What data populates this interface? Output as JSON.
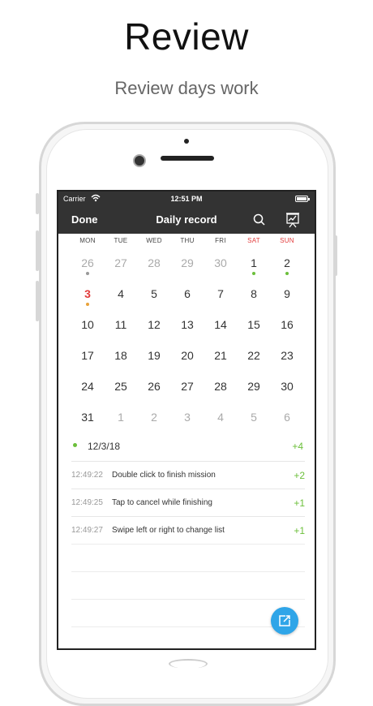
{
  "promo": {
    "title": "Review",
    "subtitle": "Review days work"
  },
  "status_bar": {
    "carrier": "Carrier",
    "time": "12:51 PM",
    "icons": [
      "wifi-icon",
      "battery-icon"
    ]
  },
  "nav": {
    "left_label": "Done",
    "title": "Daily record",
    "right_icons": [
      "search-icon",
      "chart-icon"
    ]
  },
  "calendar": {
    "weekdays": [
      "MON",
      "TUE",
      "WED",
      "THU",
      "FRI",
      "SAT",
      "SUN"
    ],
    "weeks": [
      [
        "26",
        "27",
        "28",
        "29",
        "30",
        "1",
        "2"
      ],
      [
        "3",
        "4",
        "5",
        "6",
        "7",
        "8",
        "9"
      ],
      [
        "10",
        "11",
        "12",
        "13",
        "14",
        "15",
        "16"
      ],
      [
        "17",
        "18",
        "19",
        "20",
        "21",
        "22",
        "23"
      ],
      [
        "24",
        "25",
        "26",
        "27",
        "28",
        "29",
        "30"
      ],
      [
        "31",
        "1",
        "2",
        "3",
        "4",
        "5",
        "6"
      ]
    ],
    "today": "3",
    "colors": {
      "weekend": "#e23b3b",
      "dot_gray": "#999999",
      "dot_green": "#6bbf3a",
      "dot_orange": "#e8a23a"
    }
  },
  "record": {
    "date": "12/3/18",
    "total": "+4",
    "items": [
      {
        "time": "12:49:22",
        "text": "Double click to finish mission",
        "points": "+2"
      },
      {
        "time": "12:49:25",
        "text": "Tap to cancel while finishing",
        "points": "+1"
      },
      {
        "time": "12:49:27",
        "text": "Swipe left or right to change list",
        "points": "+1"
      }
    ]
  },
  "fab": {
    "icon": "share-icon",
    "color": "#2fa5e8"
  }
}
